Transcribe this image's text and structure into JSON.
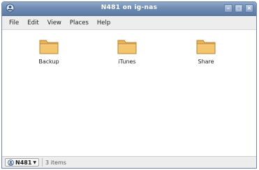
{
  "window": {
    "title": "N481 on ig-nas",
    "buttons": [
      "minimize",
      "maximize",
      "close"
    ]
  },
  "menu": [
    "File",
    "Edit",
    "View",
    "Places",
    "Help"
  ],
  "folders": [
    {
      "name": "Backup",
      "icon": "folder-icon"
    },
    {
      "name": "iTunes",
      "icon": "folder-icon"
    },
    {
      "name": "Share",
      "icon": "folder-icon"
    }
  ],
  "statusbar": {
    "location": "N481",
    "item_count": "3 items"
  },
  "colors": {
    "titlebar": "#6f8cb3",
    "folder": "#f3c56f",
    "menubar": "#ededed"
  }
}
